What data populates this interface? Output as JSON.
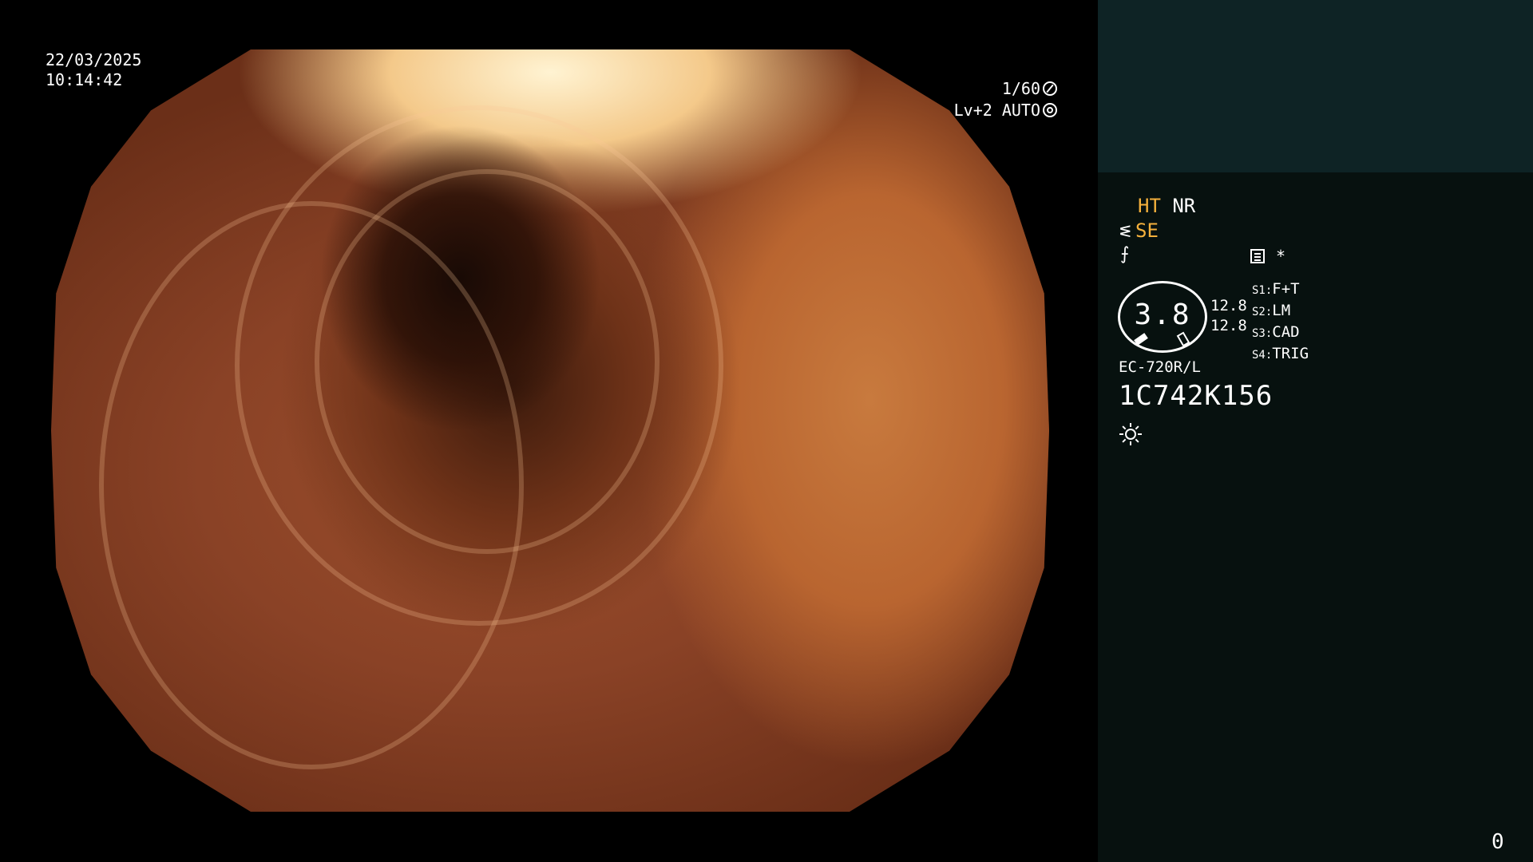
{
  "overlay": {
    "date": "22/03/2025",
    "time": "10:14:42",
    "shutter": "1/60",
    "iris": "Lv+2 AUTO"
  },
  "panel": {
    "ht": "HT",
    "nr": "NR",
    "se": "SE",
    "f_symbol": "⨍",
    "asterisk": "*",
    "gauge_value": "3.8",
    "num_1": "12.8",
    "num_2": "12.8",
    "slots": [
      {
        "key": "S1:",
        "value": "F+T"
      },
      {
        "key": "S2:",
        "value": "LM"
      },
      {
        "key": "S3:",
        "value": "CAD"
      },
      {
        "key": "S4:",
        "value": "TRIG"
      }
    ],
    "model": "EC-720R/L",
    "serial": "1C742K156",
    "counter": "0"
  },
  "colors": {
    "accent_orange": "#f4b03c",
    "panel_top": "#0e2325",
    "panel_bottom": "#07110f"
  },
  "icons": [
    "shutter-fan-icon",
    "iris-gear-icon",
    "scope-se-icon",
    "menu-list-icon",
    "light-sun-icon",
    "gauge-marker-icon"
  ]
}
